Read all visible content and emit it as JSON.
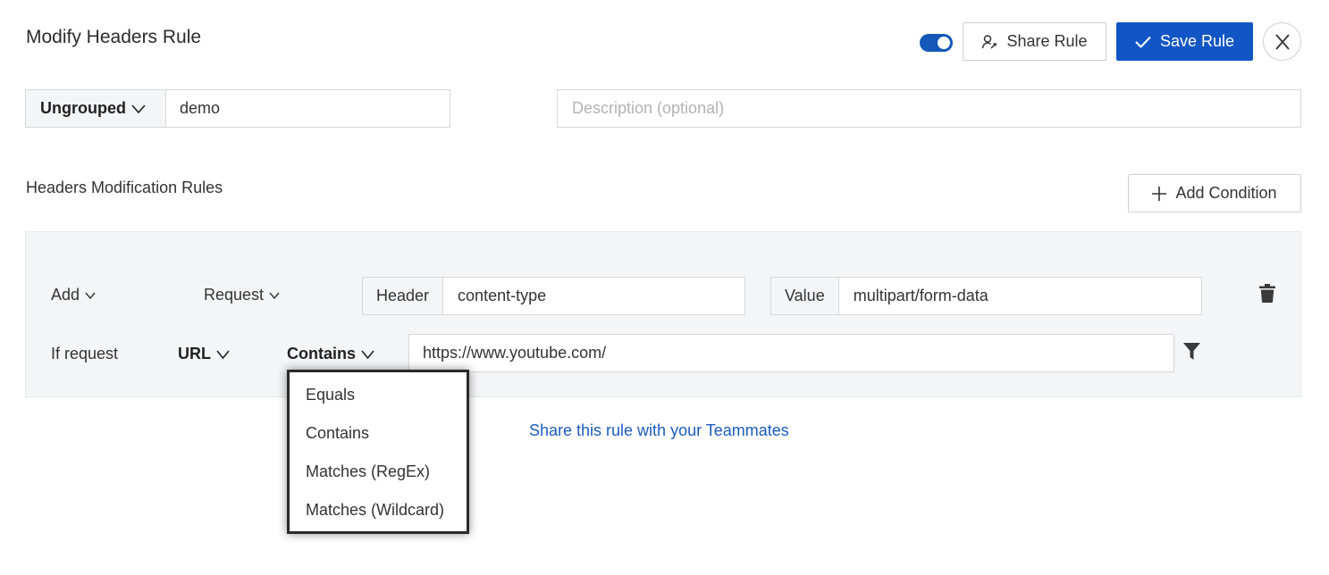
{
  "header": {
    "title": "Modify Headers Rule",
    "toggle_on": true,
    "share_label": "Share Rule",
    "save_label": "Save Rule"
  },
  "rule_meta": {
    "group": "Ungrouped",
    "name": "demo",
    "description_placeholder": "Description (optional)"
  },
  "section": {
    "label": "Headers Modification Rules",
    "add_condition_label": "Add Condition"
  },
  "modification": {
    "action": "Add",
    "target": "Request",
    "header_label": "Header",
    "header_value": "content-type",
    "value_label": "Value",
    "value_value": "multipart/form-data"
  },
  "condition": {
    "prefix": "If request",
    "source": "URL",
    "operator": "Contains",
    "url": "https://www.youtube.com/"
  },
  "operator_menu": {
    "options": [
      "Equals",
      "Contains",
      "Matches (RegEx)",
      "Matches (Wildcard)"
    ]
  },
  "share_link": "Share this rule with your Teammates",
  "colors": {
    "primary": "#1156c4",
    "link": "#1c5cbd",
    "panel_bg": "#f4f5f7"
  }
}
